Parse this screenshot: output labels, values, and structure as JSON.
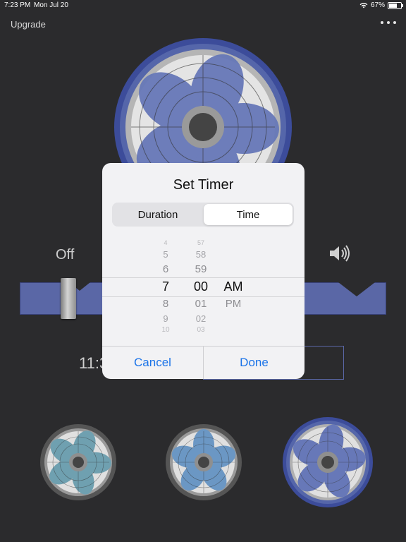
{
  "status": {
    "time": "7:23 PM",
    "date": "Mon Jul 20",
    "battery": "67%",
    "battery_level": 0.67
  },
  "topbar": {
    "upgrade_label": "Upgrade",
    "more_icon": "more-dots-icon"
  },
  "controls": {
    "off_label": "Off",
    "sound_icon": "speaker-icon",
    "timer_text_visible": "11:3"
  },
  "dialog": {
    "title": "Set Timer",
    "segments": [
      "Duration",
      "Time"
    ],
    "selected_segment": "Time",
    "picker": {
      "hours": [
        "4",
        "5",
        "6",
        "7",
        "8",
        "9",
        "10"
      ],
      "minutes": [
        "57",
        "58",
        "59",
        "00",
        "01",
        "02",
        "03"
      ],
      "ampm": [
        "AM",
        "PM"
      ],
      "selected": {
        "hour": "7",
        "minute": "00",
        "period": "AM"
      }
    },
    "cancel_label": "Cancel",
    "done_label": "Done"
  },
  "colors": {
    "background": "#2b2b2d",
    "accent_blue": "#5a67a6",
    "link_blue": "#1a73e8",
    "fan_teal": "#6fa0b0"
  },
  "fans": [
    {
      "style": "gray-teal",
      "selected": false
    },
    {
      "style": "gray-blue",
      "selected": false
    },
    {
      "style": "blue",
      "selected": true
    }
  ]
}
